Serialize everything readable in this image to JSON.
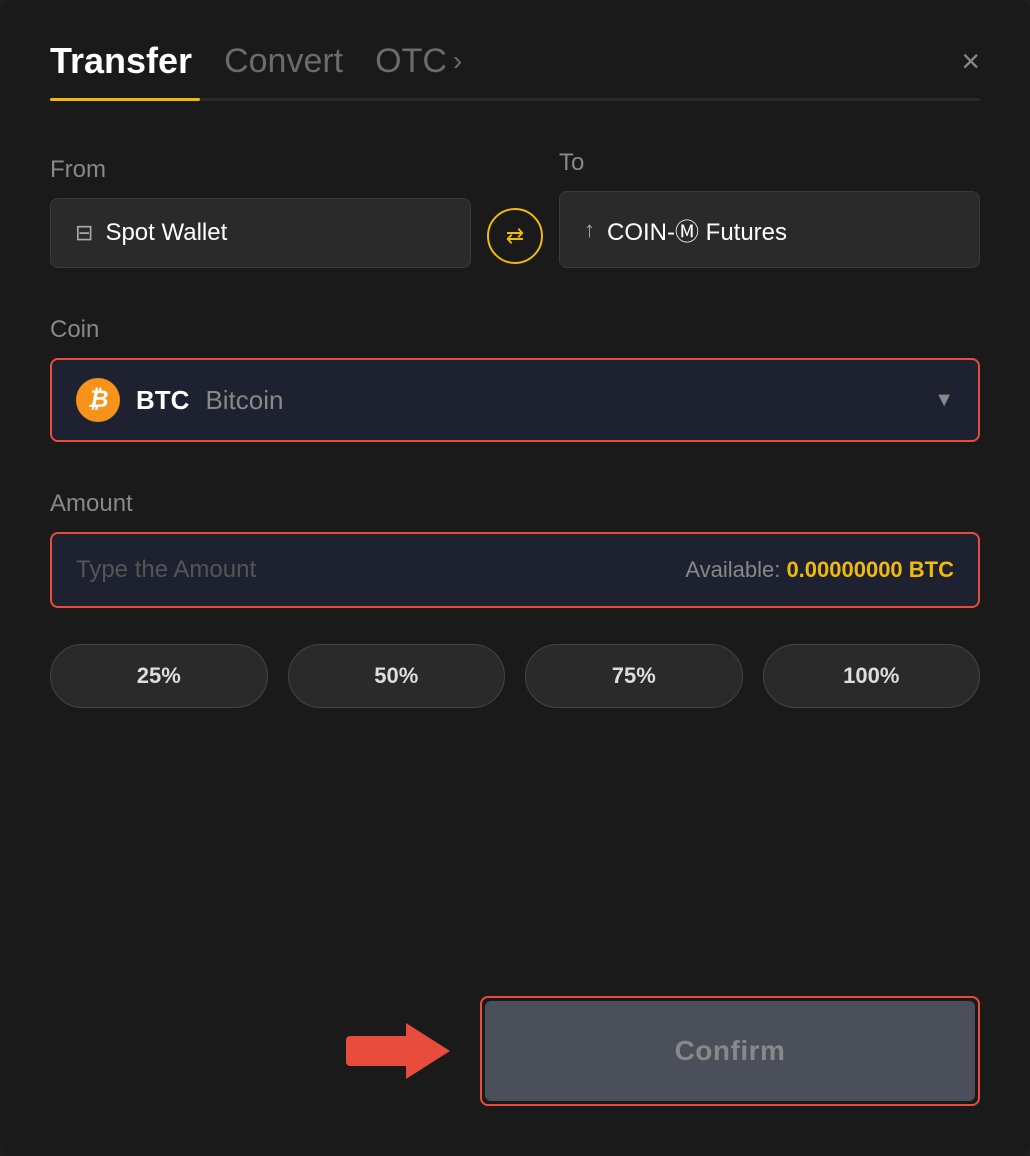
{
  "header": {
    "tab_transfer": "Transfer",
    "tab_convert": "Convert",
    "tab_otc": "OTC",
    "tab_otc_chevron": "›",
    "close_label": "×"
  },
  "from": {
    "label": "From",
    "wallet_name": "Spot Wallet"
  },
  "to": {
    "label": "To",
    "wallet_name": "COIN-Ⓜ Futures"
  },
  "coin": {
    "label": "Coin",
    "ticker": "BTC",
    "name": "Bitcoin"
  },
  "amount": {
    "label": "Amount",
    "placeholder": "Type the Amount",
    "available_label": "Available:",
    "available_value": "0.00000000 BTC"
  },
  "percent_buttons": [
    "25%",
    "50%",
    "75%",
    "100%"
  ],
  "confirm_button": "Confirm"
}
